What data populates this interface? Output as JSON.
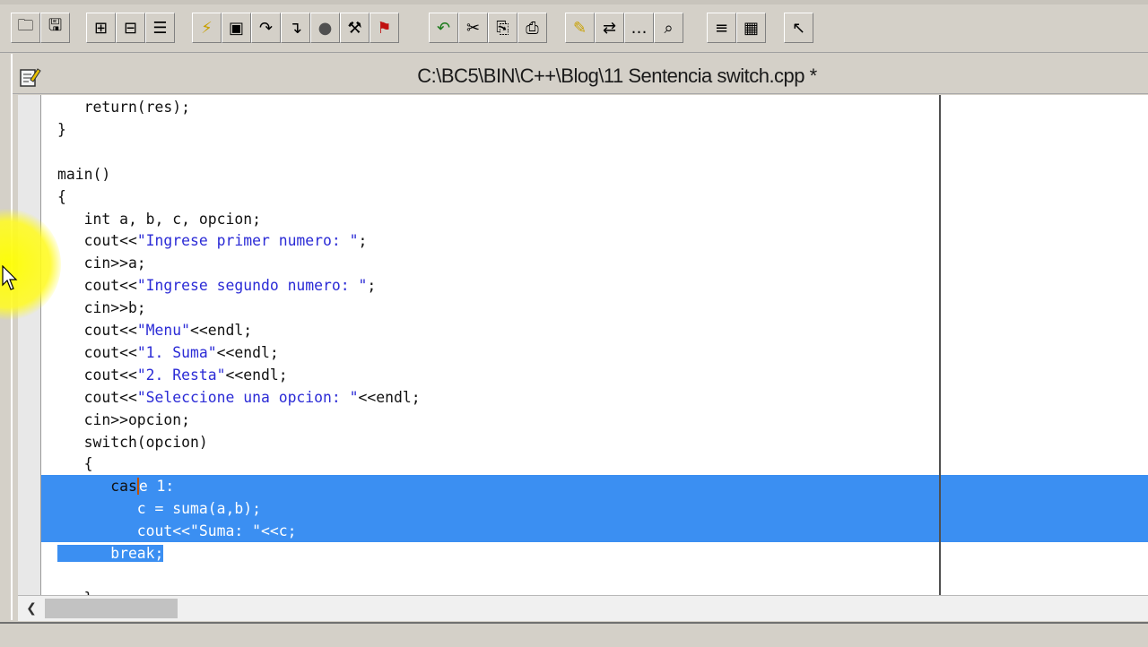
{
  "window": {
    "title": "C:\\BC5\\BIN\\C++\\Blog\\11 Sentencia switch.cpp *"
  },
  "toolbar": {
    "groups": [
      [
        "open-project-icon",
        "save-project-icon"
      ],
      [
        "add-node-icon",
        "delete-node-icon",
        "node-attributes-icon"
      ],
      [
        "lightning-make-icon",
        "compile-icon",
        "step-over-icon",
        "trace-into-icon",
        "stop-icon",
        "wrench-icon",
        "toggle-breakpoint-icon"
      ],
      [
        "undo-icon",
        "cut-icon",
        "copy-icon",
        "paste-icon"
      ],
      [
        "highlight-icon",
        "replace-icon",
        "find-next-icon",
        "search-again-icon"
      ],
      [
        "view-list-icon",
        "view-grid-icon"
      ],
      [
        "help-pointer-icon"
      ]
    ]
  },
  "code": {
    "lines": [
      [
        {
          "t": "   return(res);"
        }
      ],
      [
        {
          "t": "}"
        }
      ],
      [
        {
          "t": ""
        }
      ],
      [
        {
          "t": "main()"
        }
      ],
      [
        {
          "t": "{"
        }
      ],
      [
        {
          "t": "   int a, b, c, opcion;"
        }
      ],
      [
        {
          "t": "   cout<<"
        },
        {
          "t": "\"Ingrese primer numero: \"",
          "c": "str"
        },
        {
          "t": ";"
        }
      ],
      [
        {
          "t": "   cin>>a;"
        }
      ],
      [
        {
          "t": "   cout<<"
        },
        {
          "t": "\"Ingrese segundo numero: \"",
          "c": "str"
        },
        {
          "t": ";"
        }
      ],
      [
        {
          "t": "   cin>>b;"
        }
      ],
      [
        {
          "t": "   cout<<"
        },
        {
          "t": "\"Menu\"",
          "c": "str"
        },
        {
          "t": "<<endl;"
        }
      ],
      [
        {
          "t": "   cout<<"
        },
        {
          "t": "\"1. Suma\"",
          "c": "str"
        },
        {
          "t": "<<endl;"
        }
      ],
      [
        {
          "t": "   cout<<"
        },
        {
          "t": "\"2. Resta\"",
          "c": "str"
        },
        {
          "t": "<<endl;"
        }
      ],
      [
        {
          "t": "   cout<<"
        },
        {
          "t": "\"Seleccione una opcion: \"",
          "c": "str"
        },
        {
          "t": "<<endl;"
        }
      ],
      [
        {
          "t": "   cin>>opcion;"
        }
      ],
      [
        {
          "t": "   switch(opcion)"
        }
      ],
      [
        {
          "t": "   {"
        }
      ],
      [
        {
          "t": "      cas"
        },
        {
          "t": "e 1:",
          "c": "sel caret"
        }
      ],
      [
        {
          "t": "         c = suma(a,b);",
          "c": "sel"
        }
      ],
      [
        {
          "t": "         cout<<\"Suma: \"<<c;",
          "c": "sel"
        }
      ],
      [
        {
          "t": "      break;",
          "c": "sel"
        }
      ],
      [
        {
          "t": ""
        }
      ],
      [
        {
          "t": "   }"
        }
      ]
    ],
    "fullSelectedLines": [
      17,
      18,
      19
    ]
  }
}
